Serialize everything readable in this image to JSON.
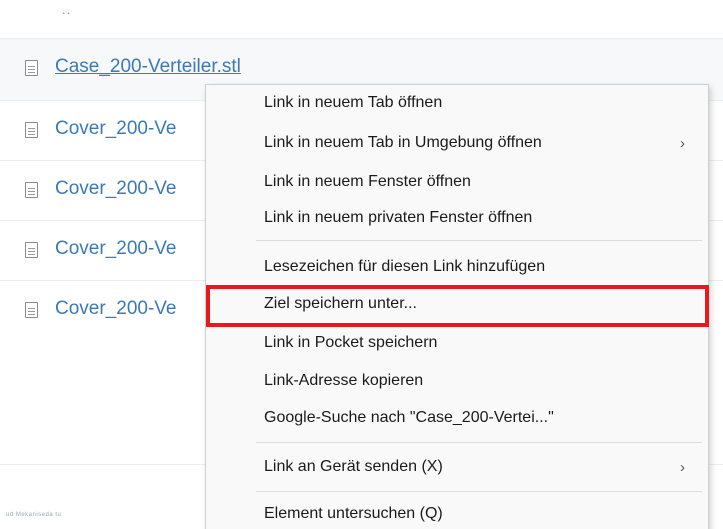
{
  "listing": {
    "parent_link": "..",
    "files": [
      {
        "name": "Case_200-Verteiler.stl"
      },
      {
        "name": "Cover_200-Ve"
      },
      {
        "name": "Cover_200-Ve"
      },
      {
        "name": "Cover_200-Ve"
      },
      {
        "name": "Cover_200-Ve"
      }
    ],
    "footer_text": "ud Mekaniseda tu"
  },
  "context_menu": {
    "items": [
      {
        "label": "Link in neuem Tab öffnen",
        "submenu": false
      },
      {
        "label": "Link in neuem Tab in Umgebung öffnen",
        "submenu": true
      },
      {
        "label": "Link in neuem Fenster öffnen",
        "submenu": false
      },
      {
        "label": "Link in neuem privaten Fenster öffnen",
        "submenu": false
      },
      {
        "label": "Lesezeichen für diesen Link hinzufügen",
        "submenu": false
      },
      {
        "label": "Ziel speichern unter...",
        "submenu": false,
        "highlighted": true
      },
      {
        "label": "Link in Pocket speichern",
        "submenu": false
      },
      {
        "label": "Link-Adresse kopieren",
        "submenu": false
      },
      {
        "label": "Google-Suche nach \"Case_200-Vertei...\"",
        "submenu": false
      },
      {
        "label": "Link an Gerät senden (X)",
        "submenu": true
      },
      {
        "label": "Element untersuchen (Q)",
        "submenu": false
      }
    ],
    "submenu_glyph": "›"
  },
  "colors": {
    "link": "#3c79b6",
    "highlight_border": "#e8181c",
    "menu_background": "#f9f9f9"
  }
}
